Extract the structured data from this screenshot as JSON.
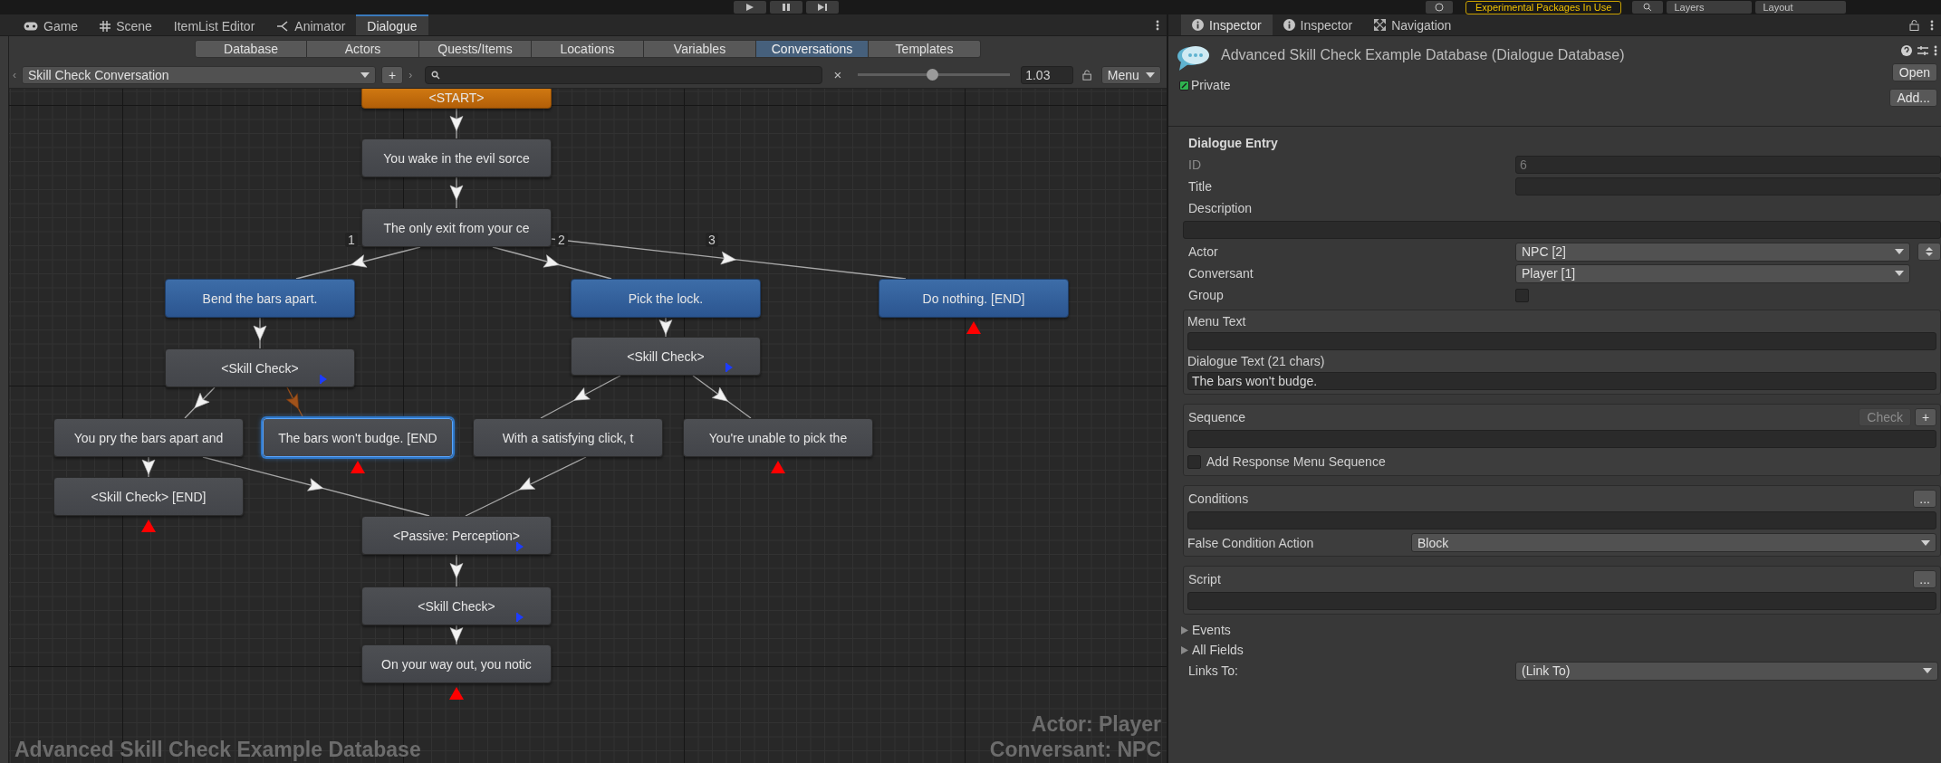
{
  "top_toolbar": {
    "notice": "Experimental Packages In Use",
    "layers": "Layers",
    "layout": "Layout"
  },
  "editor_tabs": [
    {
      "label": "Game",
      "kind": "game",
      "selected": false
    },
    {
      "label": "Scene",
      "kind": "scene",
      "selected": false
    },
    {
      "label": "ItemList Editor",
      "kind": "plain",
      "selected": false
    },
    {
      "label": "Animator",
      "kind": "animator",
      "selected": false
    },
    {
      "label": "Dialogue",
      "kind": "plain",
      "selected": true
    }
  ],
  "dialogue_tabs": [
    {
      "label": "Database",
      "selected": false
    },
    {
      "label": "Actors",
      "selected": false
    },
    {
      "label": "Quests/Items",
      "selected": false
    },
    {
      "label": "Locations",
      "selected": false
    },
    {
      "label": "Variables",
      "selected": false
    },
    {
      "label": "Conversations",
      "selected": true
    },
    {
      "label": "Templates",
      "selected": false
    }
  ],
  "conversation_bar": {
    "back": "‹",
    "forward": "›",
    "conversation": "Skill Check Conversation",
    "add": "+",
    "clear": "×",
    "zoom": {
      "level": 0.49
    },
    "zoom_value": "1.03",
    "menu": "Menu"
  },
  "canvas": {
    "nodes": [
      {
        "text": "<START>",
        "kind": "start",
        "selected": false,
        "end_mark": false,
        "flag_mark": false
      },
      {
        "text": "You wake in the evil sorce",
        "kind": "npc",
        "selected": false,
        "end_mark": false,
        "flag_mark": false
      },
      {
        "text": "The only exit from your ce",
        "kind": "npc",
        "selected": false,
        "end_mark": false,
        "flag_mark": false
      },
      {
        "text": "Bend the bars apart.",
        "kind": "player",
        "selected": false,
        "end_mark": false,
        "flag_mark": false
      },
      {
        "text": "Pick the lock.",
        "kind": "player",
        "selected": false,
        "end_mark": false,
        "flag_mark": false
      },
      {
        "text": "Do nothing. [END]",
        "kind": "player",
        "selected": false,
        "end_mark": true,
        "flag_mark": false
      },
      {
        "text": "<Skill Check>",
        "kind": "npc",
        "selected": false,
        "end_mark": false,
        "flag_mark": true
      },
      {
        "text": "<Skill Check>",
        "kind": "npc",
        "selected": false,
        "end_mark": false,
        "flag_mark": true
      },
      {
        "text": "You pry the bars apart and",
        "kind": "npc",
        "selected": false,
        "end_mark": false,
        "flag_mark": false
      },
      {
        "text": "The bars won't budge. [END",
        "kind": "npc",
        "selected": true,
        "end_mark": true,
        "flag_mark": false
      },
      {
        "text": "With a satisfying click, t",
        "kind": "npc",
        "selected": false,
        "end_mark": false,
        "flag_mark": false
      },
      {
        "text": "You're unable to pick the",
        "kind": "npc",
        "selected": false,
        "end_mark": true,
        "flag_mark": false
      },
      {
        "text": "<Skill Check> [END]",
        "kind": "npc",
        "selected": false,
        "end_mark": true,
        "flag_mark": false
      },
      {
        "text": "<Passive: Perception>",
        "kind": "npc",
        "selected": false,
        "end_mark": false,
        "flag_mark": true
      },
      {
        "text": "<Skill Check>",
        "kind": "npc",
        "selected": false,
        "end_mark": false,
        "flag_mark": true
      },
      {
        "text": "On your way out, you notic",
        "kind": "npc",
        "selected": false,
        "end_mark": true,
        "flag_mark": false
      }
    ],
    "links": [
      {
        "highlighted": false
      },
      {
        "highlighted": false
      },
      {
        "label": "1",
        "highlighted": false
      },
      {
        "label": "2",
        "highlighted": false
      },
      {
        "label": "3",
        "highlighted": false
      },
      {
        "highlighted": false
      },
      {
        "highlighted": false
      },
      {
        "highlighted": false
      },
      {
        "highlighted": true
      },
      {
        "highlighted": false
      },
      {
        "highlighted": false
      },
      {
        "highlighted": false
      },
      {
        "highlighted": false
      },
      {
        "highlighted": false
      },
      {
        "highlighted": false
      },
      {
        "highlighted": false
      }
    ],
    "database_caption": "Advanced Skill Check Example Database",
    "actor_caption": "Actor: Player",
    "conversant_caption": "Conversant: NPC"
  },
  "inspector": {
    "tabs": [
      {
        "label": "Inspector",
        "kind": "info",
        "selected": true
      },
      {
        "label": "Inspector",
        "kind": "info",
        "selected": false
      },
      {
        "label": "Navigation",
        "kind": "nav",
        "selected": false
      }
    ],
    "asset_title": "Advanced Skill Check Example Database (Dialogue Database)",
    "open": "Open",
    "private": {
      "label": "Private",
      "checked": true
    },
    "add": "Add...",
    "entry": {
      "heading": "Dialogue Entry",
      "id": {
        "label": "ID",
        "value": "6",
        "disabled": true
      },
      "title": {
        "label": "Title"
      },
      "description": {
        "label": "Description"
      },
      "actor": {
        "label": "Actor",
        "value": "NPC [2]"
      },
      "conversant": {
        "label": "Conversant",
        "value": "Player [1]"
      },
      "group": {
        "label": "Group",
        "checked": false
      },
      "menu_text": {
        "label": "Menu Text"
      },
      "dialogue_text": {
        "label": "Dialogue Text (21 chars)",
        "value": "The bars won't budge."
      },
      "sequence": {
        "label": "Sequence",
        "check": "Check",
        "add": "+",
        "response_menu": {
          "label": "Add Response Menu Sequence",
          "checked": false
        }
      },
      "conditions": {
        "label": "Conditions",
        "more": "...",
        "false_action_label": "False Condition Action",
        "false_action": "Block"
      },
      "script": {
        "label": "Script",
        "more": "..."
      },
      "foldouts": [
        {
          "label": "Events",
          "expanded": false
        },
        {
          "label": "All Fields",
          "expanded": false
        }
      ],
      "links_to": {
        "label": "Links To:",
        "value": "(Link To)"
      }
    }
  }
}
